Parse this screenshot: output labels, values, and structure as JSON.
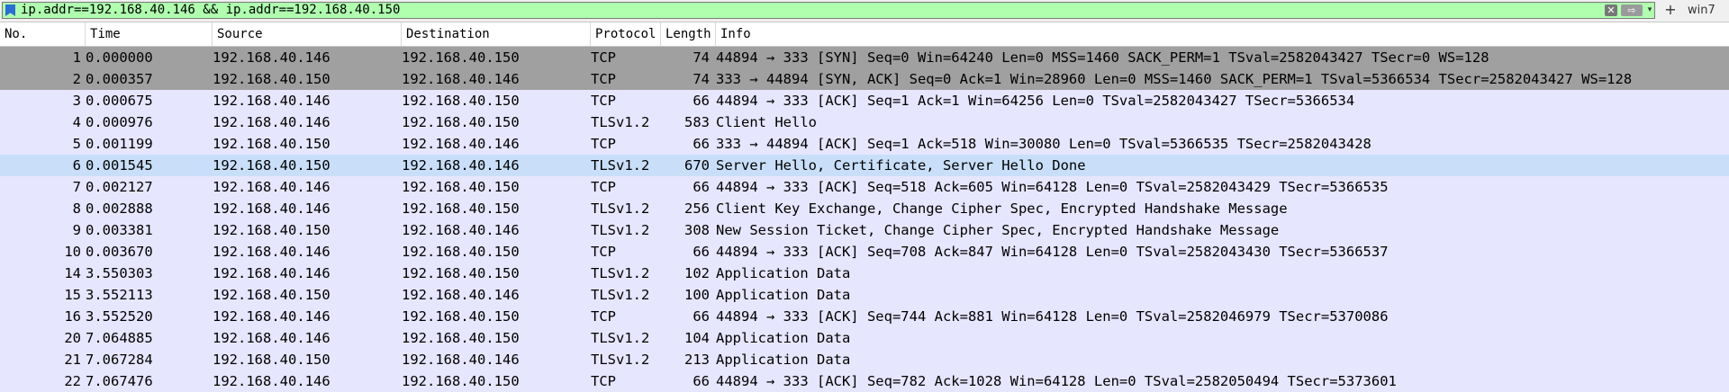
{
  "filter": {
    "text": "ip.addr==192.168.40.146 && ip.addr==192.168.40.150",
    "clear_symbol": "✕",
    "apply_symbol": "⇨",
    "dropdown_symbol": "▾",
    "add_symbol": "+",
    "profile_label": "win7"
  },
  "columns": {
    "no": "No.",
    "time": "Time",
    "source": "Source",
    "destination": "Destination",
    "protocol": "Protocol",
    "length": "Length",
    "info": "Info"
  },
  "colors": {
    "filter_valid": "#afffaf",
    "row_syn": "#a0a0a0",
    "row_tcp": "#e7e6ff",
    "row_selected": "#c9dff9"
  },
  "packets": [
    {
      "no": "1",
      "time": "0.000000",
      "src": "192.168.40.146",
      "dst": "192.168.40.150",
      "proto": "TCP",
      "len": "74",
      "info": "44894 → 333 [SYN] Seq=0 Win=64240 Len=0 MSS=1460 SACK_PERM=1 TSval=2582043427 TSecr=0 WS=128",
      "style": "syn"
    },
    {
      "no": "2",
      "time": "0.000357",
      "src": "192.168.40.150",
      "dst": "192.168.40.146",
      "proto": "TCP",
      "len": "74",
      "info": "333 → 44894 [SYN, ACK] Seq=0 Ack=1 Win=28960 Len=0 MSS=1460 SACK_PERM=1 TSval=5366534 TSecr=2582043427 WS=128",
      "style": "syn"
    },
    {
      "no": "3",
      "time": "0.000675",
      "src": "192.168.40.146",
      "dst": "192.168.40.150",
      "proto": "TCP",
      "len": "66",
      "info": "44894 → 333 [ACK] Seq=1 Ack=1 Win=64256 Len=0 TSval=2582043427 TSecr=5366534",
      "style": "normal"
    },
    {
      "no": "4",
      "time": "0.000976",
      "src": "192.168.40.146",
      "dst": "192.168.40.150",
      "proto": "TLSv1.2",
      "len": "583",
      "info": "Client Hello",
      "style": "normal"
    },
    {
      "no": "5",
      "time": "0.001199",
      "src": "192.168.40.150",
      "dst": "192.168.40.146",
      "proto": "TCP",
      "len": "66",
      "info": "333 → 44894 [ACK] Seq=1 Ack=518 Win=30080 Len=0 TSval=5366535 TSecr=2582043428",
      "style": "normal"
    },
    {
      "no": "6",
      "time": "0.001545",
      "src": "192.168.40.150",
      "dst": "192.168.40.146",
      "proto": "TLSv1.2",
      "len": "670",
      "info": "Server Hello, Certificate, Server Hello Done",
      "style": "selected"
    },
    {
      "no": "7",
      "time": "0.002127",
      "src": "192.168.40.146",
      "dst": "192.168.40.150",
      "proto": "TCP",
      "len": "66",
      "info": "44894 → 333 [ACK] Seq=518 Ack=605 Win=64128 Len=0 TSval=2582043429 TSecr=5366535",
      "style": "normal"
    },
    {
      "no": "8",
      "time": "0.002888",
      "src": "192.168.40.146",
      "dst": "192.168.40.150",
      "proto": "TLSv1.2",
      "len": "256",
      "info": "Client Key Exchange, Change Cipher Spec, Encrypted Handshake Message",
      "style": "normal"
    },
    {
      "no": "9",
      "time": "0.003381",
      "src": "192.168.40.150",
      "dst": "192.168.40.146",
      "proto": "TLSv1.2",
      "len": "308",
      "info": "New Session Ticket, Change Cipher Spec, Encrypted Handshake Message",
      "style": "normal"
    },
    {
      "no": "10",
      "time": "0.003670",
      "src": "192.168.40.146",
      "dst": "192.168.40.150",
      "proto": "TCP",
      "len": "66",
      "info": "44894 → 333 [ACK] Seq=708 Ack=847 Win=64128 Len=0 TSval=2582043430 TSecr=5366537",
      "style": "normal"
    },
    {
      "no": "14",
      "time": "3.550303",
      "src": "192.168.40.146",
      "dst": "192.168.40.150",
      "proto": "TLSv1.2",
      "len": "102",
      "info": "Application Data",
      "style": "normal"
    },
    {
      "no": "15",
      "time": "3.552113",
      "src": "192.168.40.150",
      "dst": "192.168.40.146",
      "proto": "TLSv1.2",
      "len": "100",
      "info": "Application Data",
      "style": "normal"
    },
    {
      "no": "16",
      "time": "3.552520",
      "src": "192.168.40.146",
      "dst": "192.168.40.150",
      "proto": "TCP",
      "len": "66",
      "info": "44894 → 333 [ACK] Seq=744 Ack=881 Win=64128 Len=0 TSval=2582046979 TSecr=5370086",
      "style": "normal"
    },
    {
      "no": "20",
      "time": "7.064885",
      "src": "192.168.40.146",
      "dst": "192.168.40.150",
      "proto": "TLSv1.2",
      "len": "104",
      "info": "Application Data",
      "style": "normal"
    },
    {
      "no": "21",
      "time": "7.067284",
      "src": "192.168.40.150",
      "dst": "192.168.40.146",
      "proto": "TLSv1.2",
      "len": "213",
      "info": "Application Data",
      "style": "normal"
    },
    {
      "no": "22",
      "time": "7.067476",
      "src": "192.168.40.146",
      "dst": "192.168.40.150",
      "proto": "TCP",
      "len": "66",
      "info": "44894 → 333 [ACK] Seq=782 Ack=1028 Win=64128 Len=0 TSval=2582050494 TSecr=5373601",
      "style": "normal"
    }
  ]
}
